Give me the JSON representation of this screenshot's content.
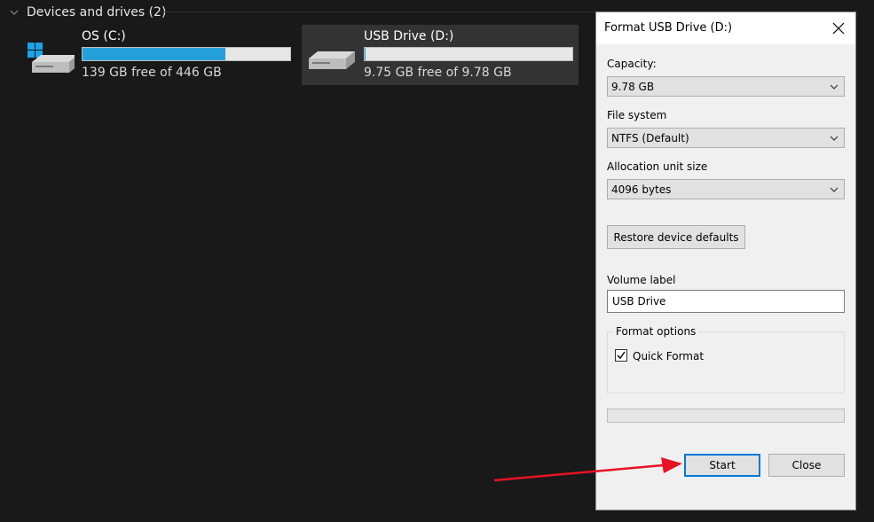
{
  "explorer": {
    "section_title": "Devices and drives (2)",
    "drives": [
      {
        "name": "OS (C:)",
        "free_text": "139 GB free of 446 GB",
        "used_fraction": 0.69,
        "icon": "windows-drive-icon"
      },
      {
        "name": "USB Drive (D:)",
        "free_text": "9.75 GB free of 9.78 GB",
        "used_fraction": 0.003,
        "icon": "usb-drive-icon",
        "selected": true
      }
    ]
  },
  "dialog": {
    "title": "Format USB Drive (D:)",
    "capacity_label": "Capacity:",
    "capacity_value": "9.78 GB",
    "filesystem_label": "File system",
    "filesystem_value": "NTFS (Default)",
    "allocation_label": "Allocation unit size",
    "allocation_value": "4096 bytes",
    "restore_button": "Restore device defaults",
    "volume_label_label": "Volume label",
    "volume_label_value": "USB Drive",
    "format_options_legend": "Format options",
    "quick_format_label": "Quick Format",
    "quick_format_checked": true,
    "progress_fraction": 0,
    "start_button": "Start",
    "close_button": "Close"
  },
  "colors": {
    "accent": "#0078d7",
    "drive_bar_fill": "#26a0da",
    "annotation_arrow": "#e81123",
    "explorer_bg": "#191919"
  }
}
